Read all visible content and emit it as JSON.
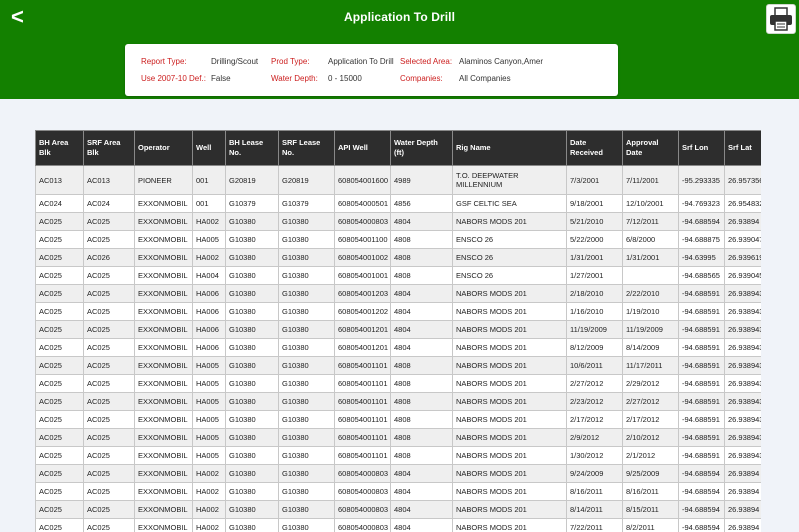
{
  "header": {
    "back_glyph": "<",
    "title": "Application To Drill",
    "print_icon": "printer-icon"
  },
  "filters": {
    "report_type_label": "Report Type:",
    "report_type_value": "Drilling/Scout",
    "prod_type_label": "Prod Type:",
    "prod_type_value": "Application To Drill",
    "selected_area_label": "Selected Area:",
    "selected_area_value": "Alaminos Canyon,Amer",
    "use_def_label": "Use 2007-10 Def.:",
    "use_def_value": "False",
    "water_depth_label": "Water Depth:",
    "water_depth_value": "0 - 15000",
    "companies_label": "Companies:",
    "companies_value": "All Companies"
  },
  "colors": {
    "header_green": "#138000",
    "label_red": "#cc1e1e",
    "table_header": "#2d2d2d"
  },
  "table": {
    "columns": [
      "BH Area Blk",
      "SRF Area Blk",
      "Operator",
      "Well",
      "BH Lease No.",
      "SRF Lease No.",
      "API Well",
      "Water Depth (ft)",
      "Rig Name",
      "Date Received",
      "Approval Date",
      "Srf Lon",
      "Srf Lat"
    ],
    "rows": [
      [
        "AC013",
        "AC013",
        "PIONEER",
        "001",
        "G20819",
        "G20819",
        "608054001600",
        "4989",
        "T.O. DEEPWATER MILLENNIUM",
        "7/3/2001",
        "7/11/2001",
        "-95.293335",
        "26.957356"
      ],
      [
        "AC024",
        "AC024",
        "EXXONMOBIL",
        "001",
        "G10379",
        "G10379",
        "608054000501",
        "4856",
        "GSF CELTIC SEA",
        "9/18/2001",
        "12/10/2001",
        "-94.769323",
        "26.954832"
      ],
      [
        "AC025",
        "AC025",
        "EXXONMOBIL",
        "HA002",
        "G10380",
        "G10380",
        "608054000803",
        "4804",
        "NABORS MODS 201",
        "5/21/2010",
        "7/12/2011",
        "-94.688594",
        "26.93894"
      ],
      [
        "AC025",
        "AC025",
        "EXXONMOBIL",
        "HA005",
        "G10380",
        "G10380",
        "608054001100",
        "4808",
        "ENSCO 26",
        "5/22/2000",
        "6/8/2000",
        "-94.688875",
        "26.939047"
      ],
      [
        "AC025",
        "AC026",
        "EXXONMOBIL",
        "HA002",
        "G10380",
        "G10380",
        "608054001002",
        "4808",
        "ENSCO 26",
        "1/31/2001",
        "1/31/2001",
        "-94.63995",
        "26.939619"
      ],
      [
        "AC025",
        "AC025",
        "EXXONMOBIL",
        "HA004",
        "G10380",
        "G10380",
        "608054001001",
        "4808",
        "ENSCO 26",
        "1/27/2001",
        "",
        "-94.688565",
        "26.939045"
      ],
      [
        "AC025",
        "AC025",
        "EXXONMOBIL",
        "HA006",
        "G10380",
        "G10380",
        "608054001203",
        "4804",
        "NABORS MODS 201",
        "2/18/2010",
        "2/22/2010",
        "-94.688591",
        "26.938943"
      ],
      [
        "AC025",
        "AC025",
        "EXXONMOBIL",
        "HA006",
        "G10380",
        "G10380",
        "608054001202",
        "4804",
        "NABORS MODS 201",
        "1/16/2010",
        "1/19/2010",
        "-94.688591",
        "26.938943"
      ],
      [
        "AC025",
        "AC025",
        "EXXONMOBIL",
        "HA006",
        "G10380",
        "G10380",
        "608054001201",
        "4804",
        "NABORS MODS 201",
        "11/19/2009",
        "11/19/2009",
        "-94.688591",
        "26.938943"
      ],
      [
        "AC025",
        "AC025",
        "EXXONMOBIL",
        "HA006",
        "G10380",
        "G10380",
        "608054001201",
        "4804",
        "NABORS MODS 201",
        "8/12/2009",
        "8/14/2009",
        "-94.688591",
        "26.938943"
      ],
      [
        "AC025",
        "AC025",
        "EXXONMOBIL",
        "HA005",
        "G10380",
        "G10380",
        "608054001101",
        "4808",
        "NABORS MODS 201",
        "10/6/2011",
        "11/17/2011",
        "-94.688591",
        "26.938943"
      ],
      [
        "AC025",
        "AC025",
        "EXXONMOBIL",
        "HA005",
        "G10380",
        "G10380",
        "608054001101",
        "4808",
        "NABORS MODS 201",
        "2/27/2012",
        "2/29/2012",
        "-94.688591",
        "26.938943"
      ],
      [
        "AC025",
        "AC025",
        "EXXONMOBIL",
        "HA005",
        "G10380",
        "G10380",
        "608054001101",
        "4808",
        "NABORS MODS 201",
        "2/23/2012",
        "2/27/2012",
        "-94.688591",
        "26.938943"
      ],
      [
        "AC025",
        "AC025",
        "EXXONMOBIL",
        "HA005",
        "G10380",
        "G10380",
        "608054001101",
        "4808",
        "NABORS MODS 201",
        "2/17/2012",
        "2/17/2012",
        "-94.688591",
        "26.938943"
      ],
      [
        "AC025",
        "AC025",
        "EXXONMOBIL",
        "HA005",
        "G10380",
        "G10380",
        "608054001101",
        "4808",
        "NABORS MODS 201",
        "2/9/2012",
        "2/10/2012",
        "-94.688591",
        "26.938943"
      ],
      [
        "AC025",
        "AC025",
        "EXXONMOBIL",
        "HA005",
        "G10380",
        "G10380",
        "608054001101",
        "4808",
        "NABORS MODS 201",
        "1/30/2012",
        "2/1/2012",
        "-94.688591",
        "26.938943"
      ],
      [
        "AC025",
        "AC025",
        "EXXONMOBIL",
        "HA002",
        "G10380",
        "G10380",
        "608054000803",
        "4804",
        "NABORS MODS 201",
        "9/24/2009",
        "9/25/2009",
        "-94.688594",
        "26.93894"
      ],
      [
        "AC025",
        "AC025",
        "EXXONMOBIL",
        "HA002",
        "G10380",
        "G10380",
        "608054000803",
        "4804",
        "NABORS MODS 201",
        "8/16/2011",
        "8/16/2011",
        "-94.688594",
        "26.93894"
      ],
      [
        "AC025",
        "AC025",
        "EXXONMOBIL",
        "HA002",
        "G10380",
        "G10380",
        "608054000803",
        "4804",
        "NABORS MODS 201",
        "8/14/2011",
        "8/15/2011",
        "-94.688594",
        "26.93894"
      ],
      [
        "AC025",
        "AC025",
        "EXXONMOBIL",
        "HA002",
        "G10380",
        "G10380",
        "608054000803",
        "4804",
        "NABORS MODS 201",
        "7/22/2011",
        "8/2/2011",
        "-94.688594",
        "26.93894"
      ]
    ]
  }
}
